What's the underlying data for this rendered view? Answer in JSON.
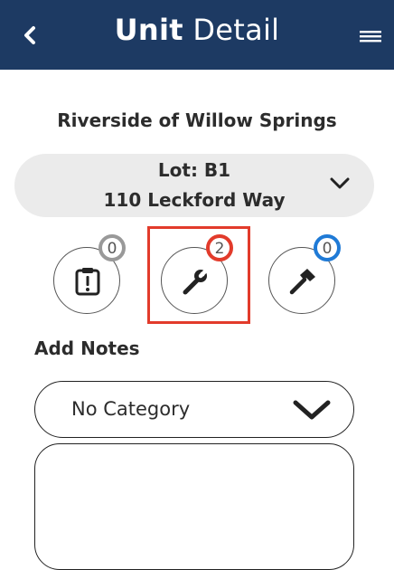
{
  "header": {
    "title_bold": "Unit",
    "title_light": "Detail",
    "back_icon": "chevron-left-icon",
    "menu_icon": "hamburger-menu-icon",
    "background": "#1d3a63"
  },
  "community_name": "Riverside of Willow Springs",
  "lot": {
    "line1": "Lot: B1",
    "line2": "110 Leckford Way"
  },
  "action_buttons": [
    {
      "icon": "clipboard-alert-icon",
      "count": "0",
      "badge_color": "#999999"
    },
    {
      "icon": "wrench-icon",
      "count": "2",
      "badge_color": "#e23b2b"
    },
    {
      "icon": "hammer-icon",
      "count": "0",
      "badge_color": "#1f7ad6"
    }
  ],
  "notes_section": {
    "label": "Add Notes",
    "category_value": "No Category",
    "notes_text": ""
  },
  "colors": {
    "highlight": "#e23b2b"
  }
}
